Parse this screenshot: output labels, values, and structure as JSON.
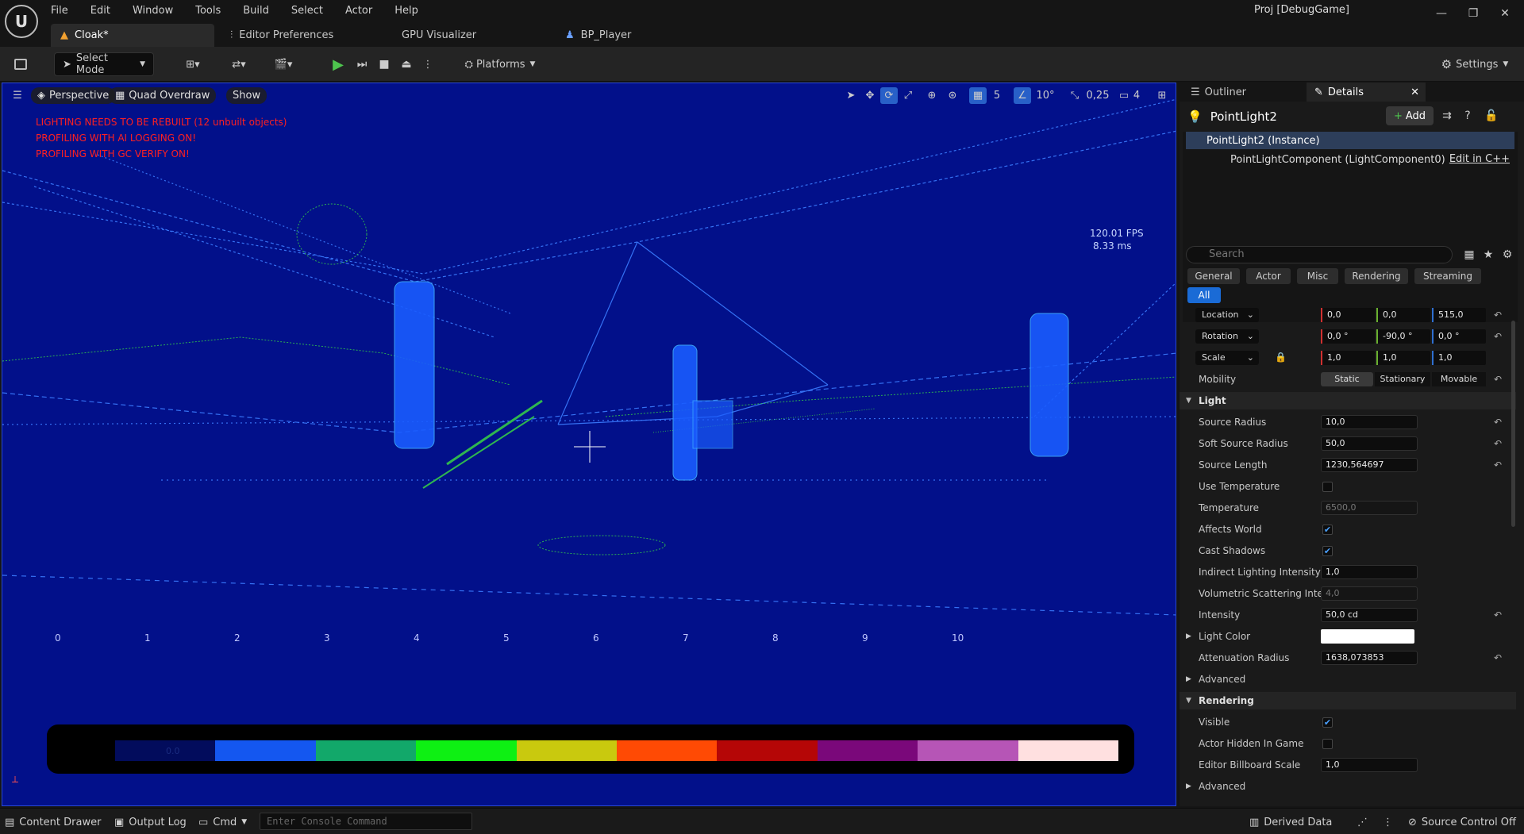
{
  "menu": [
    "File",
    "Edit",
    "Window",
    "Tools",
    "Build",
    "Select",
    "Actor",
    "Help"
  ],
  "tabs": [
    {
      "label": "Cloak*",
      "icon": "level-icon"
    },
    {
      "label": "Editor Preferences",
      "icon": "sliders-icon"
    },
    {
      "label": "GPU Visualizer"
    },
    {
      "label": "BP_Player",
      "icon": "person-icon"
    }
  ],
  "window_title": "Proj [DebugGame]",
  "toolbar": {
    "select_mode": "Select Mode",
    "platforms": "Platforms",
    "settings": "Settings"
  },
  "viewport": {
    "perspective": "Perspective",
    "view_mode": "Quad Overdraw",
    "show": "Show",
    "grid_snap": "5",
    "rot_snap": "10°",
    "scale_snap": "0,25",
    "cam_speed": "4",
    "warnings": [
      "LIGHTING NEEDS TO BE REBUILT (12 unbuilt objects)",
      "PROFILING WITH AI LOGGING ON!",
      "PROFILING WITH GC VERIFY ON!"
    ],
    "fps": "120.01 FPS",
    "ms": "8.33 ms",
    "ruler": [
      "0",
      "1",
      "2",
      "3",
      "4",
      "5",
      "6",
      "7",
      "8",
      "9",
      "10"
    ],
    "legend_zero": "0.0",
    "legend_colors": [
      "#020c5c",
      "#1457f0",
      "#12a86a",
      "#0ef013",
      "#c9c90e",
      "#ff4a04",
      "#b50606",
      "#7a087a",
      "#b655b6",
      "#ffe0e0"
    ]
  },
  "panel": {
    "tab_outliner": "Outliner",
    "tab_details": "Details",
    "object_name": "PointLight2",
    "add": "Add",
    "instance": "PointLight2 (Instance)",
    "component": "PointLightComponent (LightComponent0)",
    "edit_cpp": "Edit in C++",
    "search_placeholder": "Search",
    "categories": [
      "General",
      "Actor",
      "Misc",
      "Rendering",
      "Streaming"
    ],
    "cat_all": "All",
    "transform": {
      "location": {
        "label": "Location",
        "x": "0,0",
        "y": "0,0",
        "z": "515,0"
      },
      "rotation": {
        "label": "Rotation",
        "x": "0,0 °",
        "y": "-90,0 °",
        "z": "0,0 °"
      },
      "scale": {
        "label": "Scale",
        "x": "1,0",
        "y": "1,0",
        "z": "1,0"
      },
      "mobility": {
        "label": "Mobility",
        "static": "Static",
        "stationary": "Stationary",
        "movable": "Movable"
      }
    },
    "light_section": "Light",
    "light": {
      "source_radius": {
        "label": "Source Radius",
        "value": "10,0"
      },
      "soft_source_radius": {
        "label": "Soft Source Radius",
        "value": "50,0"
      },
      "source_length": {
        "label": "Source Length",
        "value": "1230,564697"
      },
      "use_temperature": {
        "label": "Use Temperature"
      },
      "temperature": {
        "label": "Temperature",
        "value": "6500,0"
      },
      "affects_world": {
        "label": "Affects World"
      },
      "cast_shadows": {
        "label": "Cast Shadows"
      },
      "indirect": {
        "label": "Indirect Lighting Intensity",
        "value": "1,0"
      },
      "volumetric": {
        "label": "Volumetric Scattering Inte...",
        "value": "4,0"
      },
      "intensity": {
        "label": "Intensity",
        "value": "50,0 cd"
      },
      "light_color": {
        "label": "Light Color"
      },
      "atten": {
        "label": "Attenuation Radius",
        "value": "1638,073853"
      },
      "advanced": "Advanced"
    },
    "rendering_section": "Rendering",
    "rendering": {
      "visible": {
        "label": "Visible"
      },
      "hidden": {
        "label": "Actor Hidden In Game"
      },
      "billboard": {
        "label": "Editor Billboard Scale",
        "value": "1,0"
      },
      "advanced": "Advanced"
    }
  },
  "status": {
    "content_drawer": "Content Drawer",
    "output_log": "Output Log",
    "cmd": "Cmd",
    "console_placeholder": "Enter Console Command",
    "derived_data": "Derived Data",
    "source_control": "Source Control Off"
  }
}
